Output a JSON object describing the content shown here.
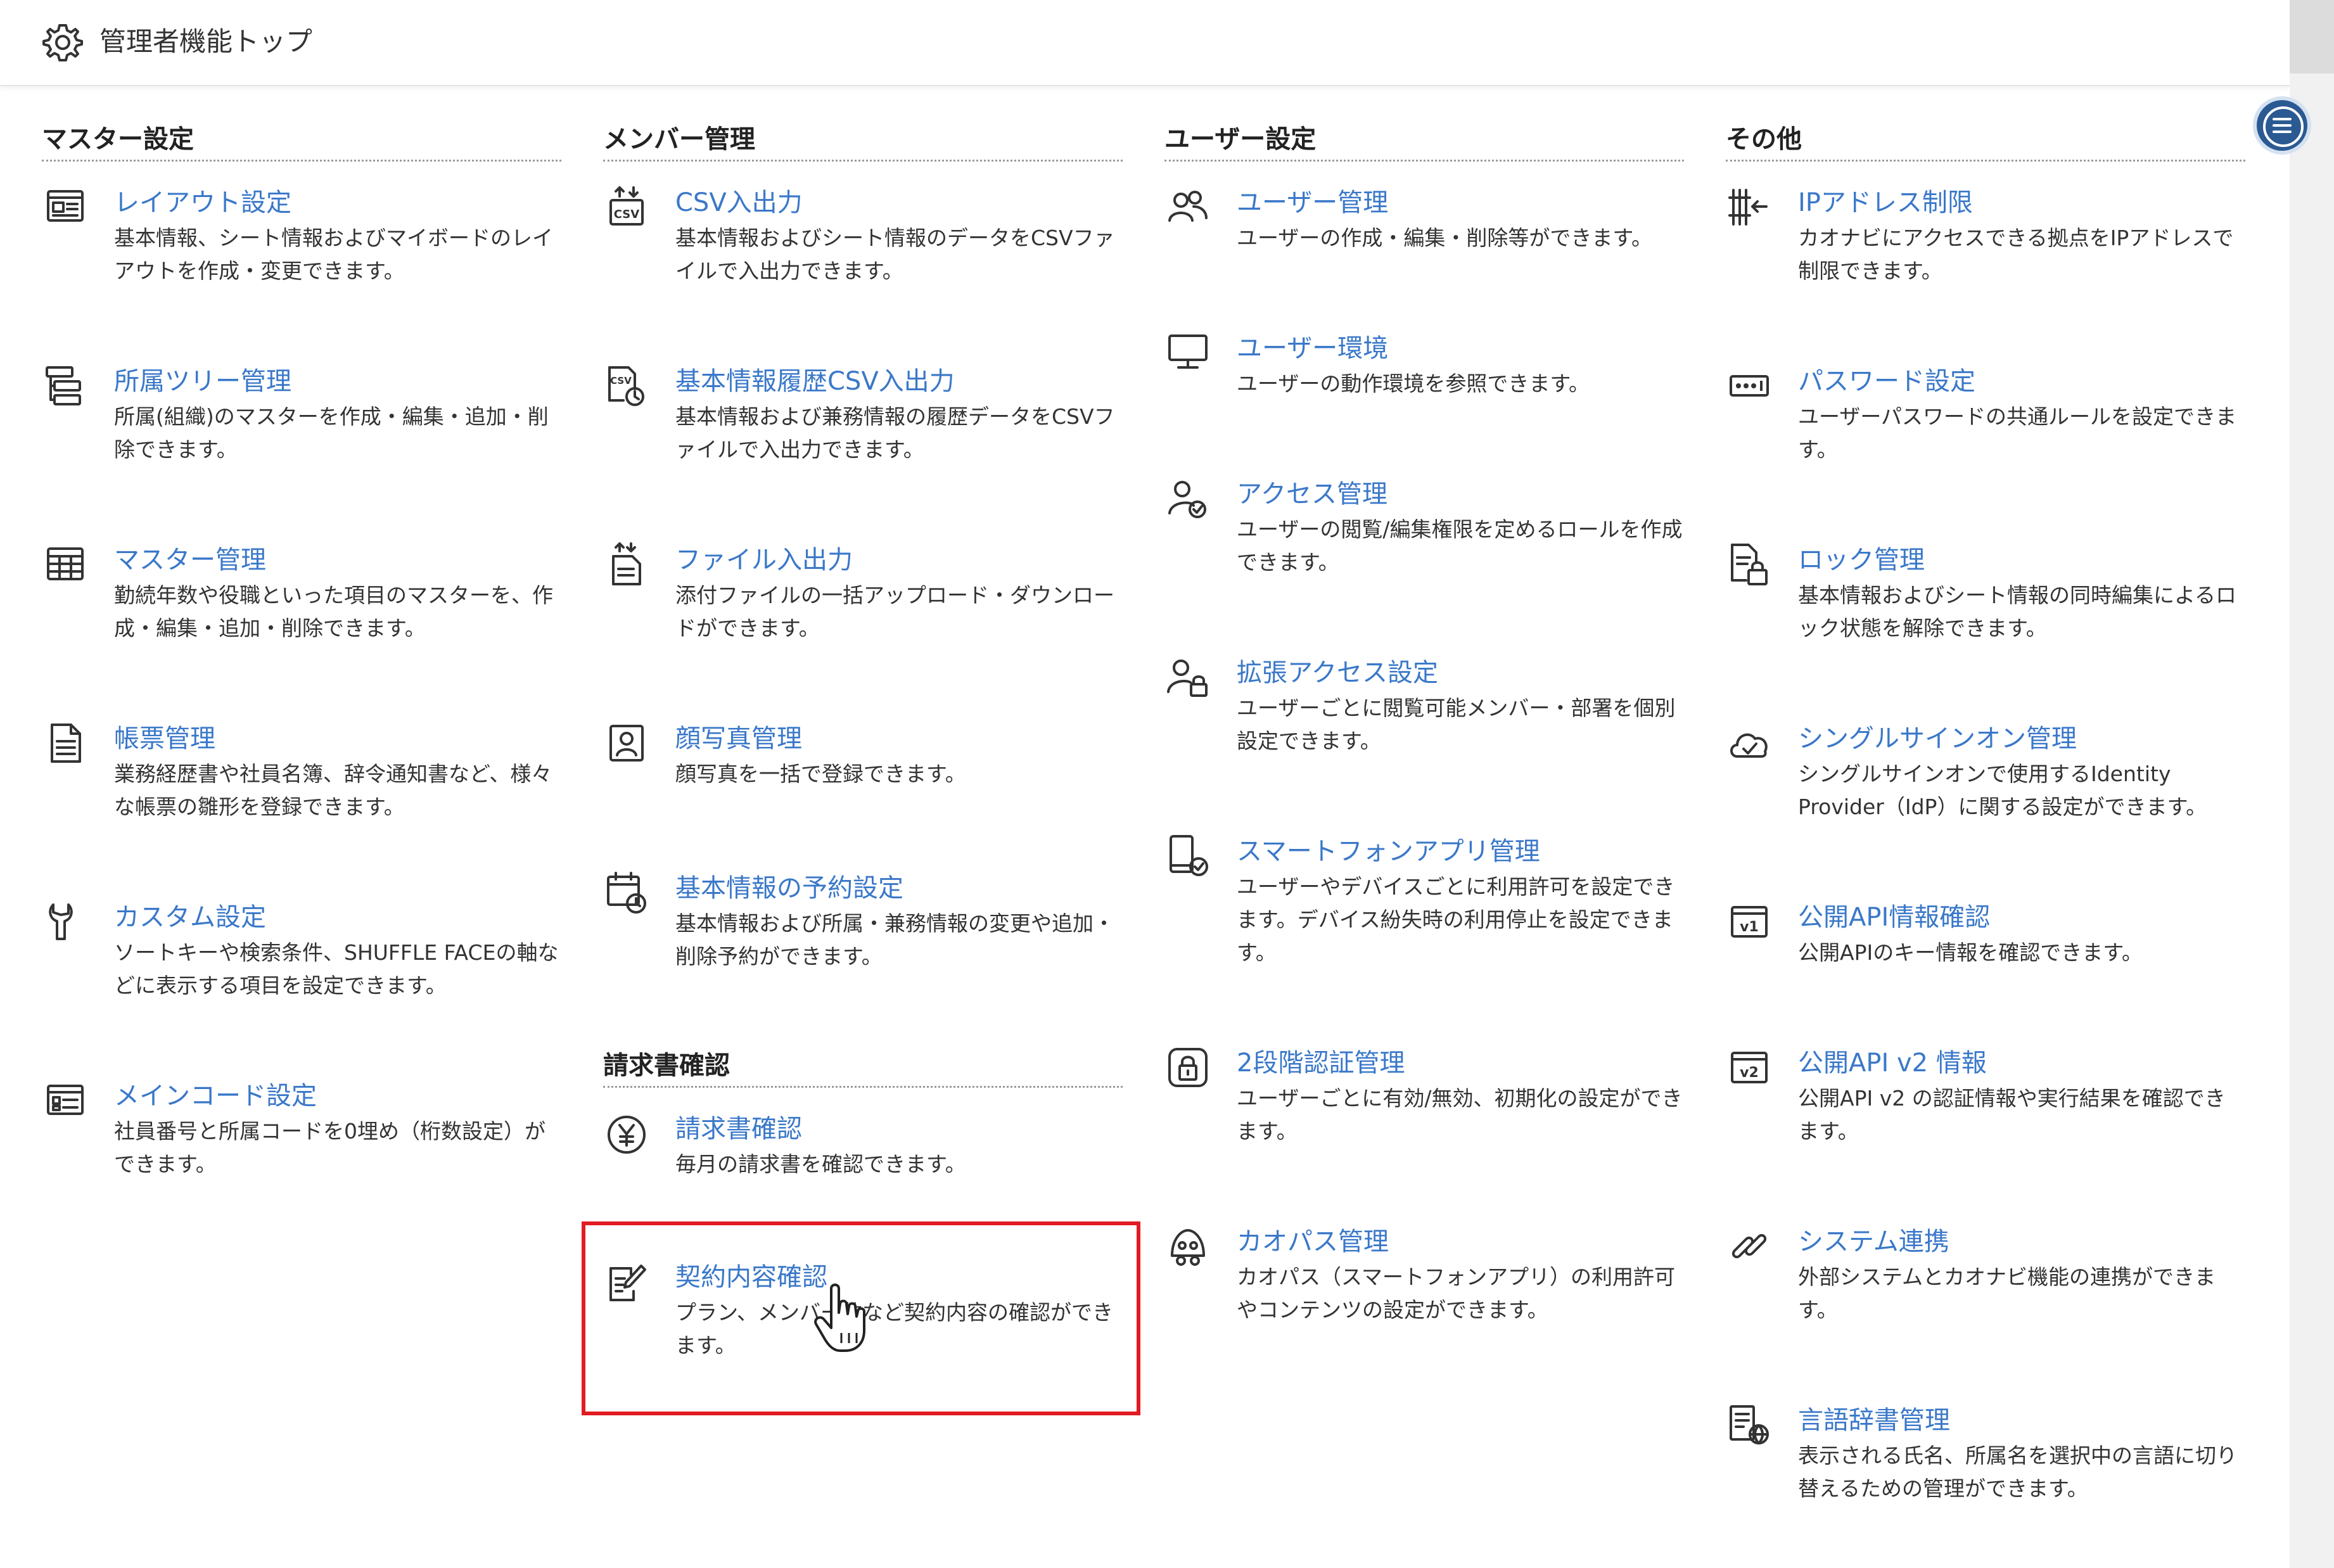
{
  "header": {
    "title": "管理者機能トップ"
  },
  "sections": {
    "master": {
      "title": "マスター設定",
      "items": [
        {
          "label": "レイアウト設定",
          "description": "基本情報、シート情報およびマイボードのレイアウトを作成・変更できます。"
        },
        {
          "label": "所属ツリー管理",
          "description": "所属(組織)のマスターを作成・編集・追加・削除できます。"
        },
        {
          "label": "マスター管理",
          "description": "勤続年数や役職といった項目のマスターを、作成・編集・追加・削除できます。"
        },
        {
          "label": "帳票管理",
          "description": "業務経歴書や社員名簿、辞令通知書など、様々な帳票の雛形を登録できます。"
        },
        {
          "label": "カスタム設定",
          "description": "ソートキーや検索条件、SHUFFLE FACEの軸などに表示する項目を設定できます。"
        },
        {
          "label": "メインコード設定",
          "description": "社員番号と所属コードを0埋め（桁数設定）ができます。"
        }
      ]
    },
    "member": {
      "title": "メンバー管理",
      "items": [
        {
          "label": "CSV入出力",
          "description": "基本情報およびシート情報のデータをCSVファイルで入出力できます。"
        },
        {
          "label": "基本情報履歴CSV入出力",
          "description": "基本情報および兼務情報の履歴データをCSVファイルで入出力できます。"
        },
        {
          "label": "ファイル入出力",
          "description": "添付ファイルの一括アップロード・ダウンロードができます。"
        },
        {
          "label": "顔写真管理",
          "description": "顔写真を一括で登録できます。"
        },
        {
          "label": "基本情報の予約設定",
          "description": "基本情報および所属・兼務情報の変更や追加・削除予約ができます。"
        }
      ]
    },
    "invoice": {
      "title": "請求書確認",
      "items": [
        {
          "label": "請求書確認",
          "description": "毎月の請求書を確認できます。"
        },
        {
          "label": "契約内容確認",
          "description": "プラン、メンバー数など契約内容の確認ができます。"
        }
      ]
    },
    "user": {
      "title": "ユーザー設定",
      "items": [
        {
          "label": "ユーザー管理",
          "description": "ユーザーの作成・編集・削除等ができます。"
        },
        {
          "label": "ユーザー環境",
          "description": "ユーザーの動作環境を参照できます。"
        },
        {
          "label": "アクセス管理",
          "description": "ユーザーの閲覧/編集権限を定めるロールを作成できます。"
        },
        {
          "label": "拡張アクセス設定",
          "description": "ユーザーごとに閲覧可能メンバー・部署を個別設定できます。"
        },
        {
          "label": "スマートフォンアプリ管理",
          "description": "ユーザーやデバイスごとに利用許可を設定できます。デバイス紛失時の利用停止を設定できます。"
        },
        {
          "label": "2段階認証管理",
          "description": "ユーザーごとに有効/無効、初期化の設定ができます。"
        },
        {
          "label": "カオパス管理",
          "description": "カオパス（スマートフォンアプリ）の利用許可やコンテンツの設定ができます。"
        }
      ]
    },
    "other": {
      "title": "その他",
      "items": [
        {
          "label": "IPアドレス制限",
          "description": "カオナビにアクセスできる拠点をIPアドレスで制限できます。"
        },
        {
          "label": "パスワード設定",
          "description": "ユーザーパスワードの共通ルールを設定できます。"
        },
        {
          "label": "ロック管理",
          "description": "基本情報およびシート情報の同時編集によるロック状態を解除できます。"
        },
        {
          "label": "シングルサインオン管理",
          "description": "シングルサインオンで使用するIdentity Provider（IdP）に関する設定ができます。"
        },
        {
          "label": "公開API情報確認",
          "description": "公開APIのキー情報を確認できます。"
        },
        {
          "label": "公開API v2 情報",
          "description": "公開API v2 の認証情報や実行結果を確認できます。"
        },
        {
          "label": "システム連携",
          "description": "外部システムとカオナビ機能の連携ができます。"
        },
        {
          "label": "言語辞書管理",
          "description": "表示される氏名、所属名を選択中の言語に切り替えるための管理ができます。"
        }
      ]
    }
  },
  "icons": {
    "master": [
      "layout-icon",
      "org-tree-icon",
      "table-icon",
      "document-icon",
      "wrench-icon",
      "code-card-icon"
    ],
    "member": [
      "csv-io-icon",
      "csv-history-icon",
      "file-io-icon",
      "portrait-icon",
      "calendar-clock-icon"
    ],
    "invoice": [
      "yen-icon",
      "contract-edit-icon"
    ],
    "user": [
      "users-icon",
      "monitor-icon",
      "user-check-icon",
      "user-lock-icon",
      "smartphone-check-icon",
      "two-factor-lock-icon",
      "kaopass-icon"
    ],
    "other": [
      "ip-restrict-icon",
      "password-icon",
      "file-lock-icon",
      "cloud-check-icon",
      "api-v1-icon",
      "api-v2-icon",
      "link-icon",
      "dictionary-globe-icon"
    ]
  },
  "colors": {
    "link": "#3a78c9",
    "highlight": "#e01b22",
    "menu_button": "#2b5a93"
  }
}
